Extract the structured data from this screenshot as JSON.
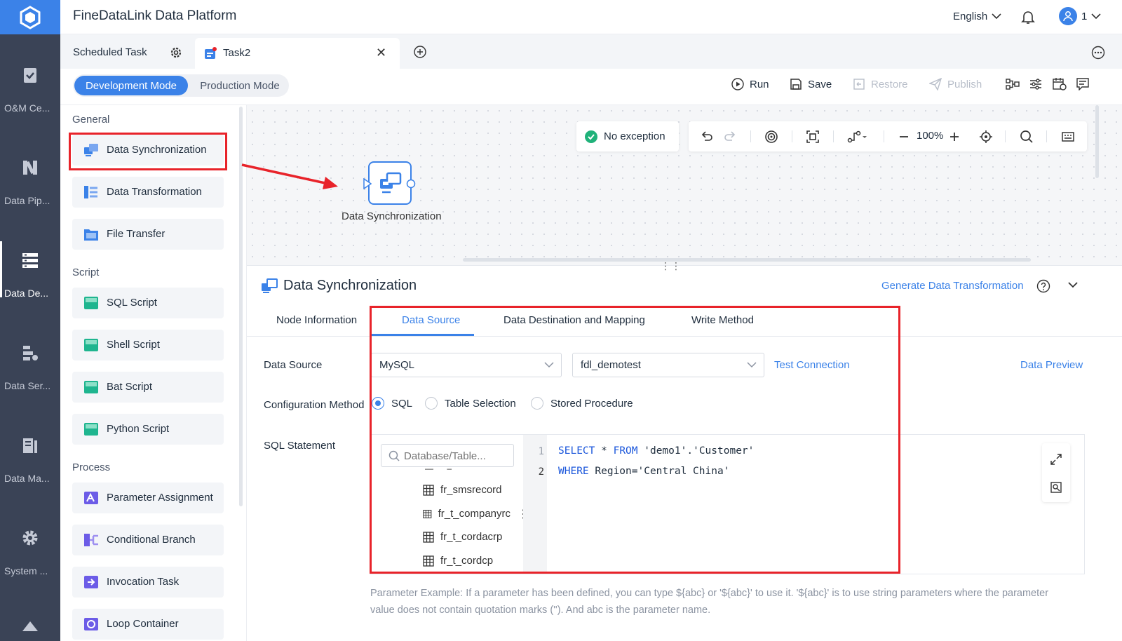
{
  "app": {
    "title": "FineDataLink Data Platform"
  },
  "header": {
    "language": "English",
    "user": "1"
  },
  "nav": {
    "items": [
      {
        "label": "O&M Ce..."
      },
      {
        "label": "Data Pip..."
      },
      {
        "label": "Data De..."
      },
      {
        "label": "Data Ser..."
      },
      {
        "label": "Data Ma..."
      },
      {
        "label": "System ..."
      }
    ]
  },
  "tabs": {
    "scheduled": "Scheduled Task",
    "task": "Task2"
  },
  "toolbar": {
    "mode_dev": "Development Mode",
    "mode_prod": "Production Mode",
    "run": "Run",
    "save": "Save",
    "restore": "Restore",
    "publish": "Publish"
  },
  "components": {
    "general_title": "General",
    "general": [
      "Data Synchronization",
      "Data Transformation",
      "File Transfer"
    ],
    "script_title": "Script",
    "script": [
      "SQL Script",
      "Shell Script",
      "Bat Script",
      "Python Script"
    ],
    "process_title": "Process",
    "process": [
      "Parameter Assignment",
      "Conditional Branch",
      "Invocation Task",
      "Loop Container"
    ]
  },
  "canvas": {
    "status": "No exception",
    "zoom": "100%",
    "node_label": "Data Synchronization"
  },
  "panel": {
    "title": "Data Synchronization",
    "generate_link": "Generate Data Transformation",
    "tabs": [
      "Node Information",
      "Data Source",
      "Data Destination and Mapping",
      "Write Method"
    ],
    "active_tab": "Data Source",
    "data_source_label": "Data Source",
    "db_type": "MySQL",
    "connection": "fdl_demotest",
    "test_connection": "Test Connection",
    "data_preview": "Data Preview",
    "config_label": "Configuration Method",
    "config_options": [
      "SQL",
      "Table Selection",
      "Stored Procedure"
    ],
    "config_selected": "SQL",
    "sql_label": "SQL Statement",
    "search_placeholder": "Database/Table...",
    "tables": [
      "fr_smsrecord",
      "fr_t_companyrc",
      "fr_t_cordacrp",
      "fr_t_cordcp"
    ],
    "code_line1_kw1": "SELECT",
    "code_line1_mid": " * ",
    "code_line1_kw2": "FROM",
    "code_line1_rest": " 'demo1'.'Customer'",
    "code_line2_kw": "WHERE",
    "code_line2_rest": " Region='Central China'",
    "line_numbers": [
      "1",
      "2"
    ],
    "param_hint": "Parameter Example: If a parameter has been defined, you can type ${abc} or '${abc}' to use it. '${abc}' is to use string parameters where the parameter value does not contain quotation marks (''). And abc is the parameter name."
  },
  "colors": {
    "accent": "#3b82e8",
    "highlight": "#e8232a",
    "nav_bg": "#3a4356"
  },
  "icons": [
    "logo-icon",
    "checklist-icon",
    "pipeline-icon",
    "development-icon",
    "service-icon",
    "data-map-icon",
    "gear-icon",
    "bell-icon",
    "user-icon",
    "run-icon",
    "save-icon",
    "restore-icon",
    "publish-icon",
    "search-icon",
    "table-icon",
    "expand-icon"
  ]
}
